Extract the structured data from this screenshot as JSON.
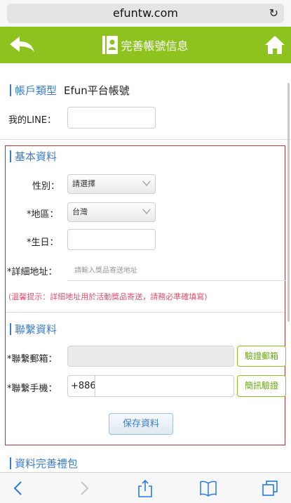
{
  "browser": {
    "url": "efuntw.com"
  },
  "header": {
    "title": "完善帳號信息"
  },
  "account": {
    "type_label": "帳戶類型",
    "type_value": "Efun平台帳號",
    "line_label": "我的LINE：",
    "line_value": ""
  },
  "basic": {
    "section_title": "基本資料",
    "gender_label": "性別：",
    "gender_value": "請選擇",
    "region_label": "*地區：",
    "region_value": "台灣",
    "birthday_label": "*生日：",
    "birthday_value": "",
    "address_label": "*詳細地址：",
    "address_placeholder": "請輸入獎品寄送地址",
    "hint": "(溫馨提示：詳細地址用於活動獎品寄送，請務必準確填寫)"
  },
  "contact": {
    "section_title": "聯繫資料",
    "email_label": "*聯繫郵箱：",
    "email_value": "",
    "verify_email_label": "驗證郵箱",
    "phone_label": "*聯繫手機：",
    "phone_prefix": "+886",
    "phone_value": "",
    "verify_sms_label": "簡訊驗證"
  },
  "actions": {
    "save_label": "保存資料"
  },
  "gift": {
    "section_title": "資料完善禮包"
  },
  "colors": {
    "accent_green": "#8dc21f",
    "link_blue": "#3a7dc9",
    "hint_red": "#e0516e",
    "box_red": "#b1373a"
  }
}
